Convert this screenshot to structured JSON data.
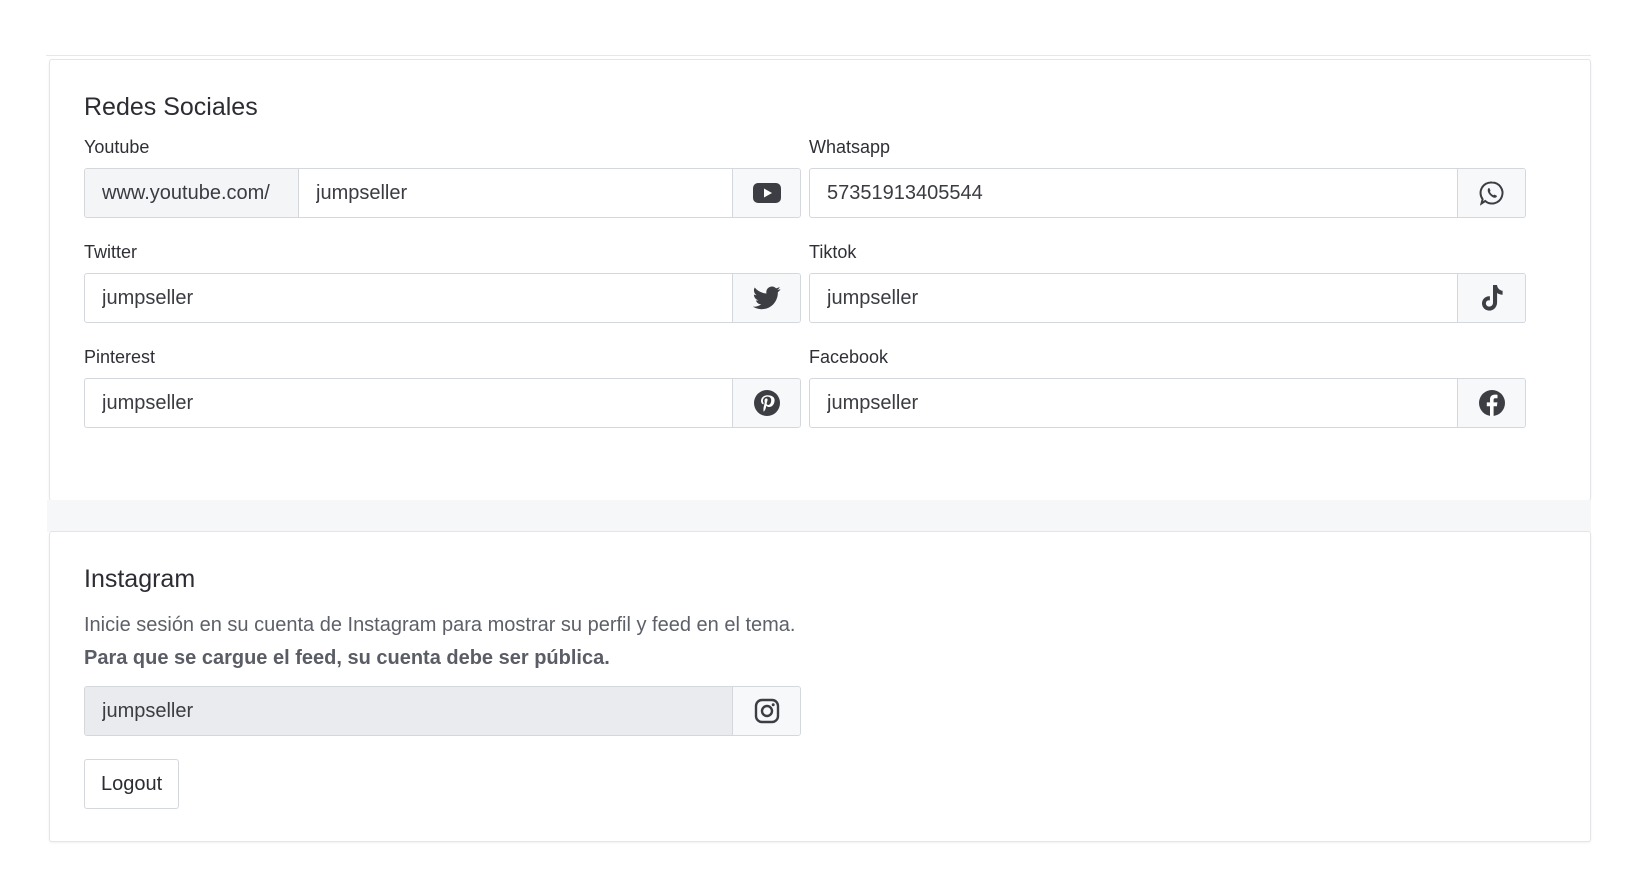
{
  "social": {
    "title": "Redes Sociales",
    "youtube": {
      "label": "Youtube",
      "prefix": "www.youtube.com/",
      "value": "jumpseller",
      "icon": "youtube-icon"
    },
    "whatsapp": {
      "label": "Whatsapp",
      "value": "57351913405544",
      "icon": "whatsapp-icon"
    },
    "twitter": {
      "label": "Twitter",
      "value": "jumpseller",
      "icon": "twitter-icon"
    },
    "tiktok": {
      "label": "Tiktok",
      "value": "jumpseller",
      "icon": "tiktok-icon"
    },
    "pinterest": {
      "label": "Pinterest",
      "value": "jumpseller",
      "icon": "pinterest-icon"
    },
    "facebook": {
      "label": "Facebook",
      "value": "jumpseller",
      "icon": "facebook-icon"
    }
  },
  "instagram": {
    "title": "Instagram",
    "description": "Inicie sesión en su cuenta de Instagram para mostrar su perfil y feed en el tema.",
    "note": "Para que se cargue el feed, su cuenta debe ser pública.",
    "value": "jumpseller",
    "icon": "instagram-icon",
    "logout_label": "Logout"
  },
  "colors": {
    "icon": "#3c3e44",
    "border": "#d4d7dc",
    "disabled_bg": "#e9ebee"
  }
}
